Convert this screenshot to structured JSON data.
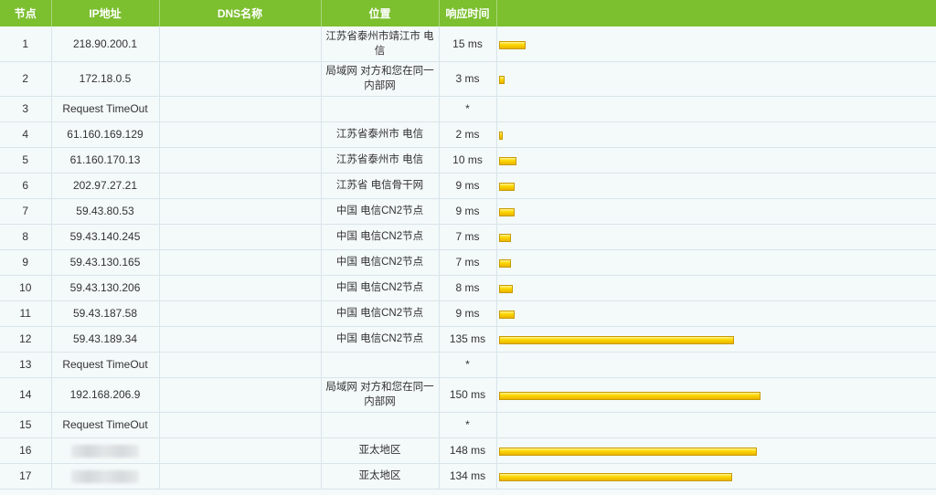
{
  "headers": {
    "hop": "节点",
    "ip": "IP地址",
    "dns": "DNS名称",
    "location": "位置",
    "time": "响应时间"
  },
  "max_time_ms": 150,
  "rows": [
    {
      "hop": "1",
      "ip": "218.90.200.1",
      "dns": "",
      "location": "江苏省泰州市靖江市 电信",
      "time": "15 ms",
      "ms": 15
    },
    {
      "hop": "2",
      "ip": "172.18.0.5",
      "dns": "",
      "location": "局域网 对方和您在同一内部网",
      "time": "3 ms",
      "ms": 3
    },
    {
      "hop": "3",
      "ip": "Request TimeOut",
      "dns": "",
      "location": "",
      "time": "*",
      "ms": null
    },
    {
      "hop": "4",
      "ip": "61.160.169.129",
      "dns": "",
      "location": "江苏省泰州市 电信",
      "time": "2 ms",
      "ms": 2
    },
    {
      "hop": "5",
      "ip": "61.160.170.13",
      "dns": "",
      "location": "江苏省泰州市 电信",
      "time": "10 ms",
      "ms": 10
    },
    {
      "hop": "6",
      "ip": "202.97.27.21",
      "dns": "",
      "location": "江苏省 电信骨干网",
      "time": "9 ms",
      "ms": 9
    },
    {
      "hop": "7",
      "ip": "59.43.80.53",
      "dns": "",
      "location": "中国 电信CN2节点",
      "time": "9 ms",
      "ms": 9
    },
    {
      "hop": "8",
      "ip": "59.43.140.245",
      "dns": "",
      "location": "中国 电信CN2节点",
      "time": "7 ms",
      "ms": 7
    },
    {
      "hop": "9",
      "ip": "59.43.130.165",
      "dns": "",
      "location": "中国 电信CN2节点",
      "time": "7 ms",
      "ms": 7
    },
    {
      "hop": "10",
      "ip": "59.43.130.206",
      "dns": "",
      "location": "中国 电信CN2节点",
      "time": "8 ms",
      "ms": 8
    },
    {
      "hop": "11",
      "ip": "59.43.187.58",
      "dns": "",
      "location": "中国 电信CN2节点",
      "time": "9 ms",
      "ms": 9
    },
    {
      "hop": "12",
      "ip": "59.43.189.34",
      "dns": "",
      "location": "中国 电信CN2节点",
      "time": "135 ms",
      "ms": 135
    },
    {
      "hop": "13",
      "ip": "Request TimeOut",
      "dns": "",
      "location": "",
      "time": "*",
      "ms": null
    },
    {
      "hop": "14",
      "ip": "192.168.206.9",
      "dns": "",
      "location": "局域网 对方和您在同一内部网",
      "time": "150 ms",
      "ms": 150
    },
    {
      "hop": "15",
      "ip": "Request TimeOut",
      "dns": "",
      "location": "",
      "time": "*",
      "ms": null
    },
    {
      "hop": "16",
      "ip": "",
      "ip_redacted": true,
      "dns": "",
      "location": "亚太地区",
      "time": "148 ms",
      "ms": 148
    },
    {
      "hop": "17",
      "ip": "",
      "ip_redacted": true,
      "dns": "",
      "location": "亚太地区",
      "time": "134 ms",
      "ms": 134
    }
  ]
}
